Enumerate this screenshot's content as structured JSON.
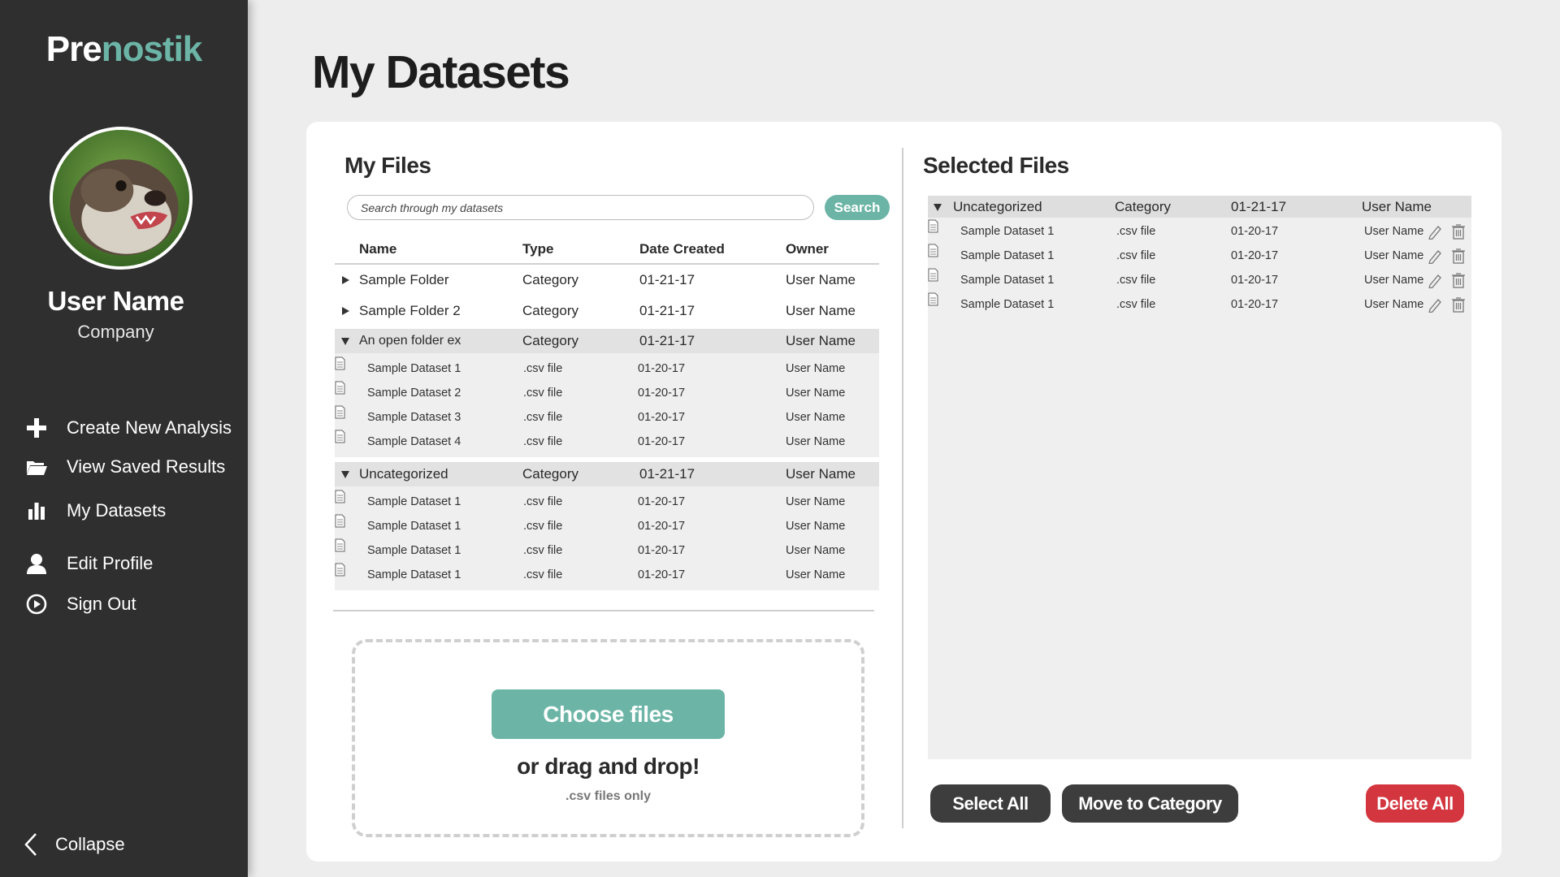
{
  "brand": {
    "part1": "Pre",
    "part2": "nostik"
  },
  "user": {
    "name": "User Name",
    "company": "Company"
  },
  "nav": [
    {
      "label": "Create New Analysis",
      "icon": "plus-icon"
    },
    {
      "label": "View Saved Results",
      "icon": "folder-open-icon"
    },
    {
      "label": "My Datasets",
      "icon": "bar-chart-icon"
    },
    {
      "label": "Edit Profile",
      "icon": "user-icon"
    },
    {
      "label": "Sign Out",
      "icon": "power-icon"
    }
  ],
  "collapse_label": "Collapse",
  "page_title": "My Datasets",
  "my_files": {
    "title": "My Files",
    "search_placeholder": "Search through my datasets",
    "search_button": "Search",
    "columns": {
      "name": "Name",
      "type": "Type",
      "date": "Date Created",
      "owner": "Owner"
    },
    "folders": [
      {
        "name": "Sample Folder",
        "type": "Category",
        "date": "01-21-17",
        "owner": "User Name"
      },
      {
        "name": "Sample Folder 2",
        "type": "Category",
        "date": "01-21-17",
        "owner": "User Name"
      }
    ],
    "open_groups": [
      {
        "name": "An open folder ex",
        "type": "Category",
        "date": "01-21-17",
        "owner": "User Name",
        "files": [
          {
            "name": "Sample Dataset 1",
            "type": ".csv file",
            "date": "01-20-17",
            "owner": "User Name"
          },
          {
            "name": "Sample Dataset 2",
            "type": ".csv file",
            "date": "01-20-17",
            "owner": "User Name"
          },
          {
            "name": "Sample Dataset 3",
            "type": ".csv file",
            "date": "01-20-17",
            "owner": "User Name"
          },
          {
            "name": "Sample Dataset 4",
            "type": ".csv file",
            "date": "01-20-17",
            "owner": "User Name"
          }
        ]
      },
      {
        "name": "Uncategorized",
        "type": "Category",
        "date": "01-21-17",
        "owner": "User Name",
        "files": [
          {
            "name": "Sample Dataset 1",
            "type": ".csv file",
            "date": "01-20-17",
            "owner": "User Name"
          },
          {
            "name": "Sample Dataset 1",
            "type": ".csv file",
            "date": "01-20-17",
            "owner": "User Name"
          },
          {
            "name": "Sample Dataset 1",
            "type": ".csv file",
            "date": "01-20-17",
            "owner": "User Name"
          },
          {
            "name": "Sample Dataset 1",
            "type": ".csv file",
            "date": "01-20-17",
            "owner": "User Name"
          }
        ]
      }
    ]
  },
  "upload": {
    "choose_label": "Choose files",
    "drag_label": "or drag and drop!",
    "hint": ".csv files only"
  },
  "selected_files": {
    "title": "Selected Files",
    "group": {
      "name": "Uncategorized",
      "type": "Category",
      "date": "01-21-17",
      "owner": "User Name"
    },
    "files": [
      {
        "name": "Sample Dataset 1",
        "type": ".csv file",
        "date": "01-20-17",
        "owner": "User Name"
      },
      {
        "name": "Sample Dataset 1",
        "type": ".csv file",
        "date": "01-20-17",
        "owner": "User Name"
      },
      {
        "name": "Sample Dataset 1",
        "type": ".csv file",
        "date": "01-20-17",
        "owner": "User Name"
      },
      {
        "name": "Sample Dataset 1",
        "type": ".csv file",
        "date": "01-20-17",
        "owner": "User Name"
      }
    ],
    "buttons": {
      "select_all": "Select All",
      "move": "Move to Category",
      "delete_all": "Delete All"
    }
  },
  "colors": {
    "accent": "#6cb5a6",
    "sidebar": "#2f2f2f",
    "danger": "#d3363e",
    "dark_button": "#3d3d3d"
  }
}
